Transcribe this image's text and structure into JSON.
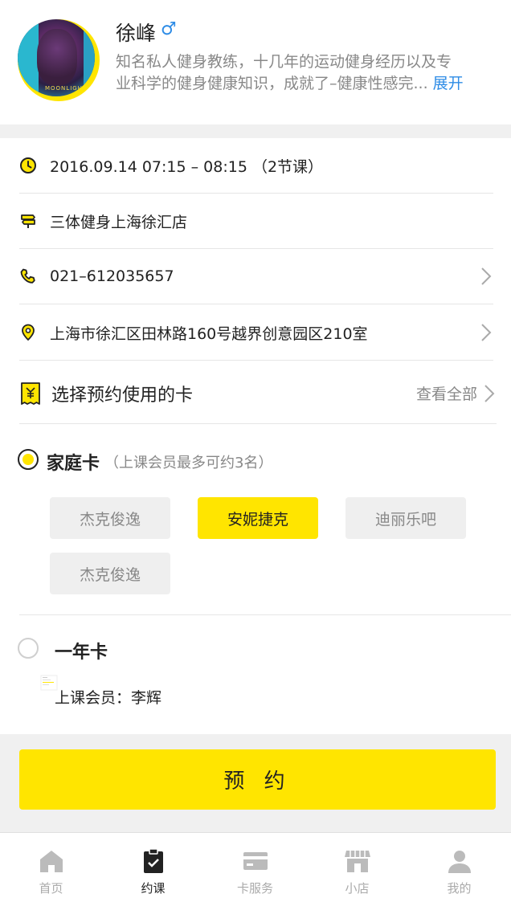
{
  "profile": {
    "name": "徐峰",
    "gender_symbol": "♂",
    "bio_line1": "知名私人健身教练，十几年的运动健身经历以及专",
    "bio_line2": "业科学的健身健康知识，成就了–健康性感完...",
    "expand_label": "展开",
    "avatar_watermark": "MOONLIGHT"
  },
  "info": {
    "datetime": "2016.09.14   07:15 – 08:15  （2节课）",
    "store": "三体健身上海徐汇店",
    "phone": "021–612035657",
    "address": "上海市徐汇区田林路160号越界创意园区210室"
  },
  "cards": {
    "header_title": "选择预约使用的卡",
    "see_all": "查看全部",
    "family": {
      "name": "家庭卡",
      "note": "（上课会员最多可约3名）",
      "members": [
        "杰克俊逸",
        "安妮捷克",
        "迪丽乐吧",
        "杰克俊逸"
      ],
      "selected_index": 1
    },
    "annual": {
      "name": "一年卡",
      "member_line": "上课会员：李辉"
    }
  },
  "book_button": "预 约",
  "tabs": [
    {
      "label": "首页",
      "icon": "home-icon"
    },
    {
      "label": "约课",
      "icon": "clipboard-check-icon"
    },
    {
      "label": "卡服务",
      "icon": "card-icon"
    },
    {
      "label": "小店",
      "icon": "shop-icon"
    },
    {
      "label": "我的",
      "icon": "person-icon"
    }
  ],
  "colors": {
    "accent": "#FFE500",
    "link": "#2E8CE6",
    "muted": "#888888",
    "background_gap": "#F0F0F0"
  }
}
